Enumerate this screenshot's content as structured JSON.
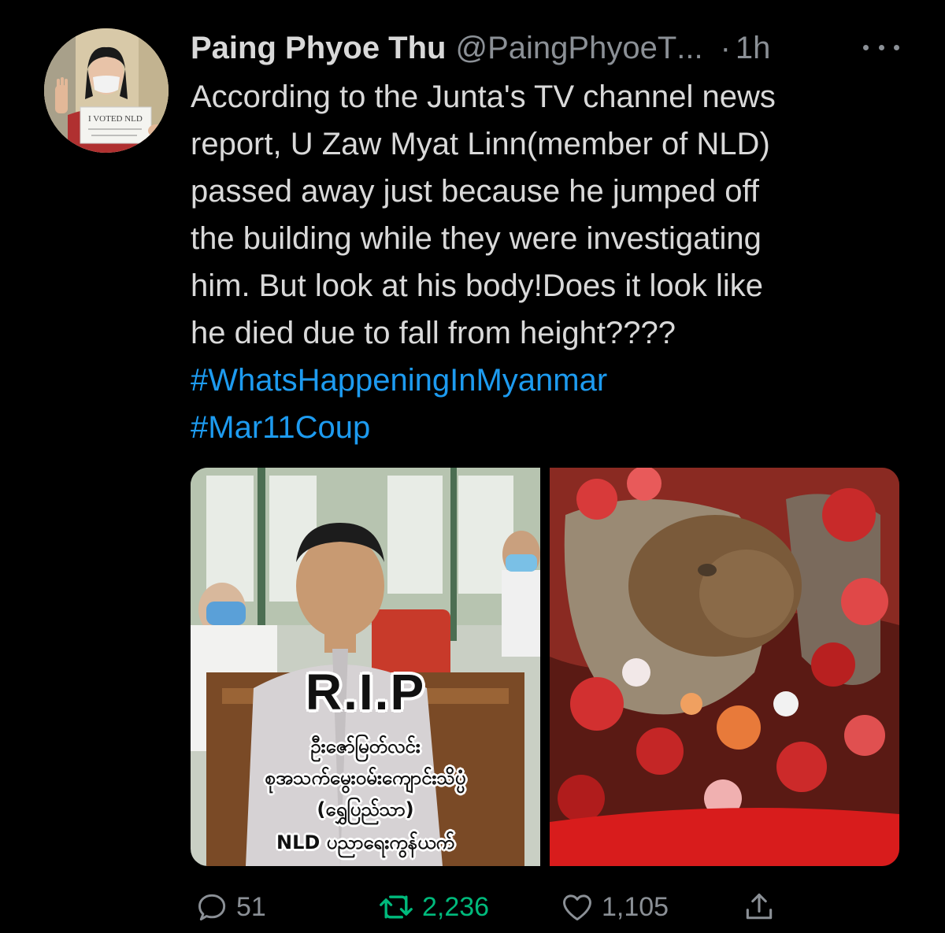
{
  "user": {
    "display_name": "Paing Phyoe Thu",
    "handle": "@PaingPhyoeT",
    "handle_ellipsis": "...",
    "time_separator": "·",
    "time": "1h",
    "avatar_sign_text": "I VOTED NLD"
  },
  "tweet": {
    "lines": [
      "According to the Junta's TV channel news",
      "report, U Zaw Myat Linn(member of NLD)",
      "passed away just because he jumped off",
      "the building while they were investigating",
      "him. But look at his body!Does it look like",
      "he died due to fall from height????"
    ],
    "hashtags": [
      "#WhatsHappeningInMyanmar",
      "#Mar11Coup"
    ]
  },
  "media": {
    "left_overlay_title": "R.I.P",
    "left_caption_lines": [
      "ဦးဇော်မြတ်လင်း",
      "စုအသက်မွေးဝမ်းကျောင်းသိပ္ပံ",
      "(ရွှေပြည်သာ)",
      "NLD ပညာရေးကွန်ယက်"
    ]
  },
  "actions": {
    "reply_count": "51",
    "retweet_count": "2,236",
    "like_count": "1,105"
  },
  "colors": {
    "background": "#000000",
    "text": "#d9d9d9",
    "muted": "#8b9096",
    "hashtag": "#1d9bf0",
    "retweet_active": "#00ba7c"
  },
  "icons": [
    "more-icon",
    "reply-icon",
    "retweet-icon",
    "like-icon",
    "share-icon"
  ]
}
